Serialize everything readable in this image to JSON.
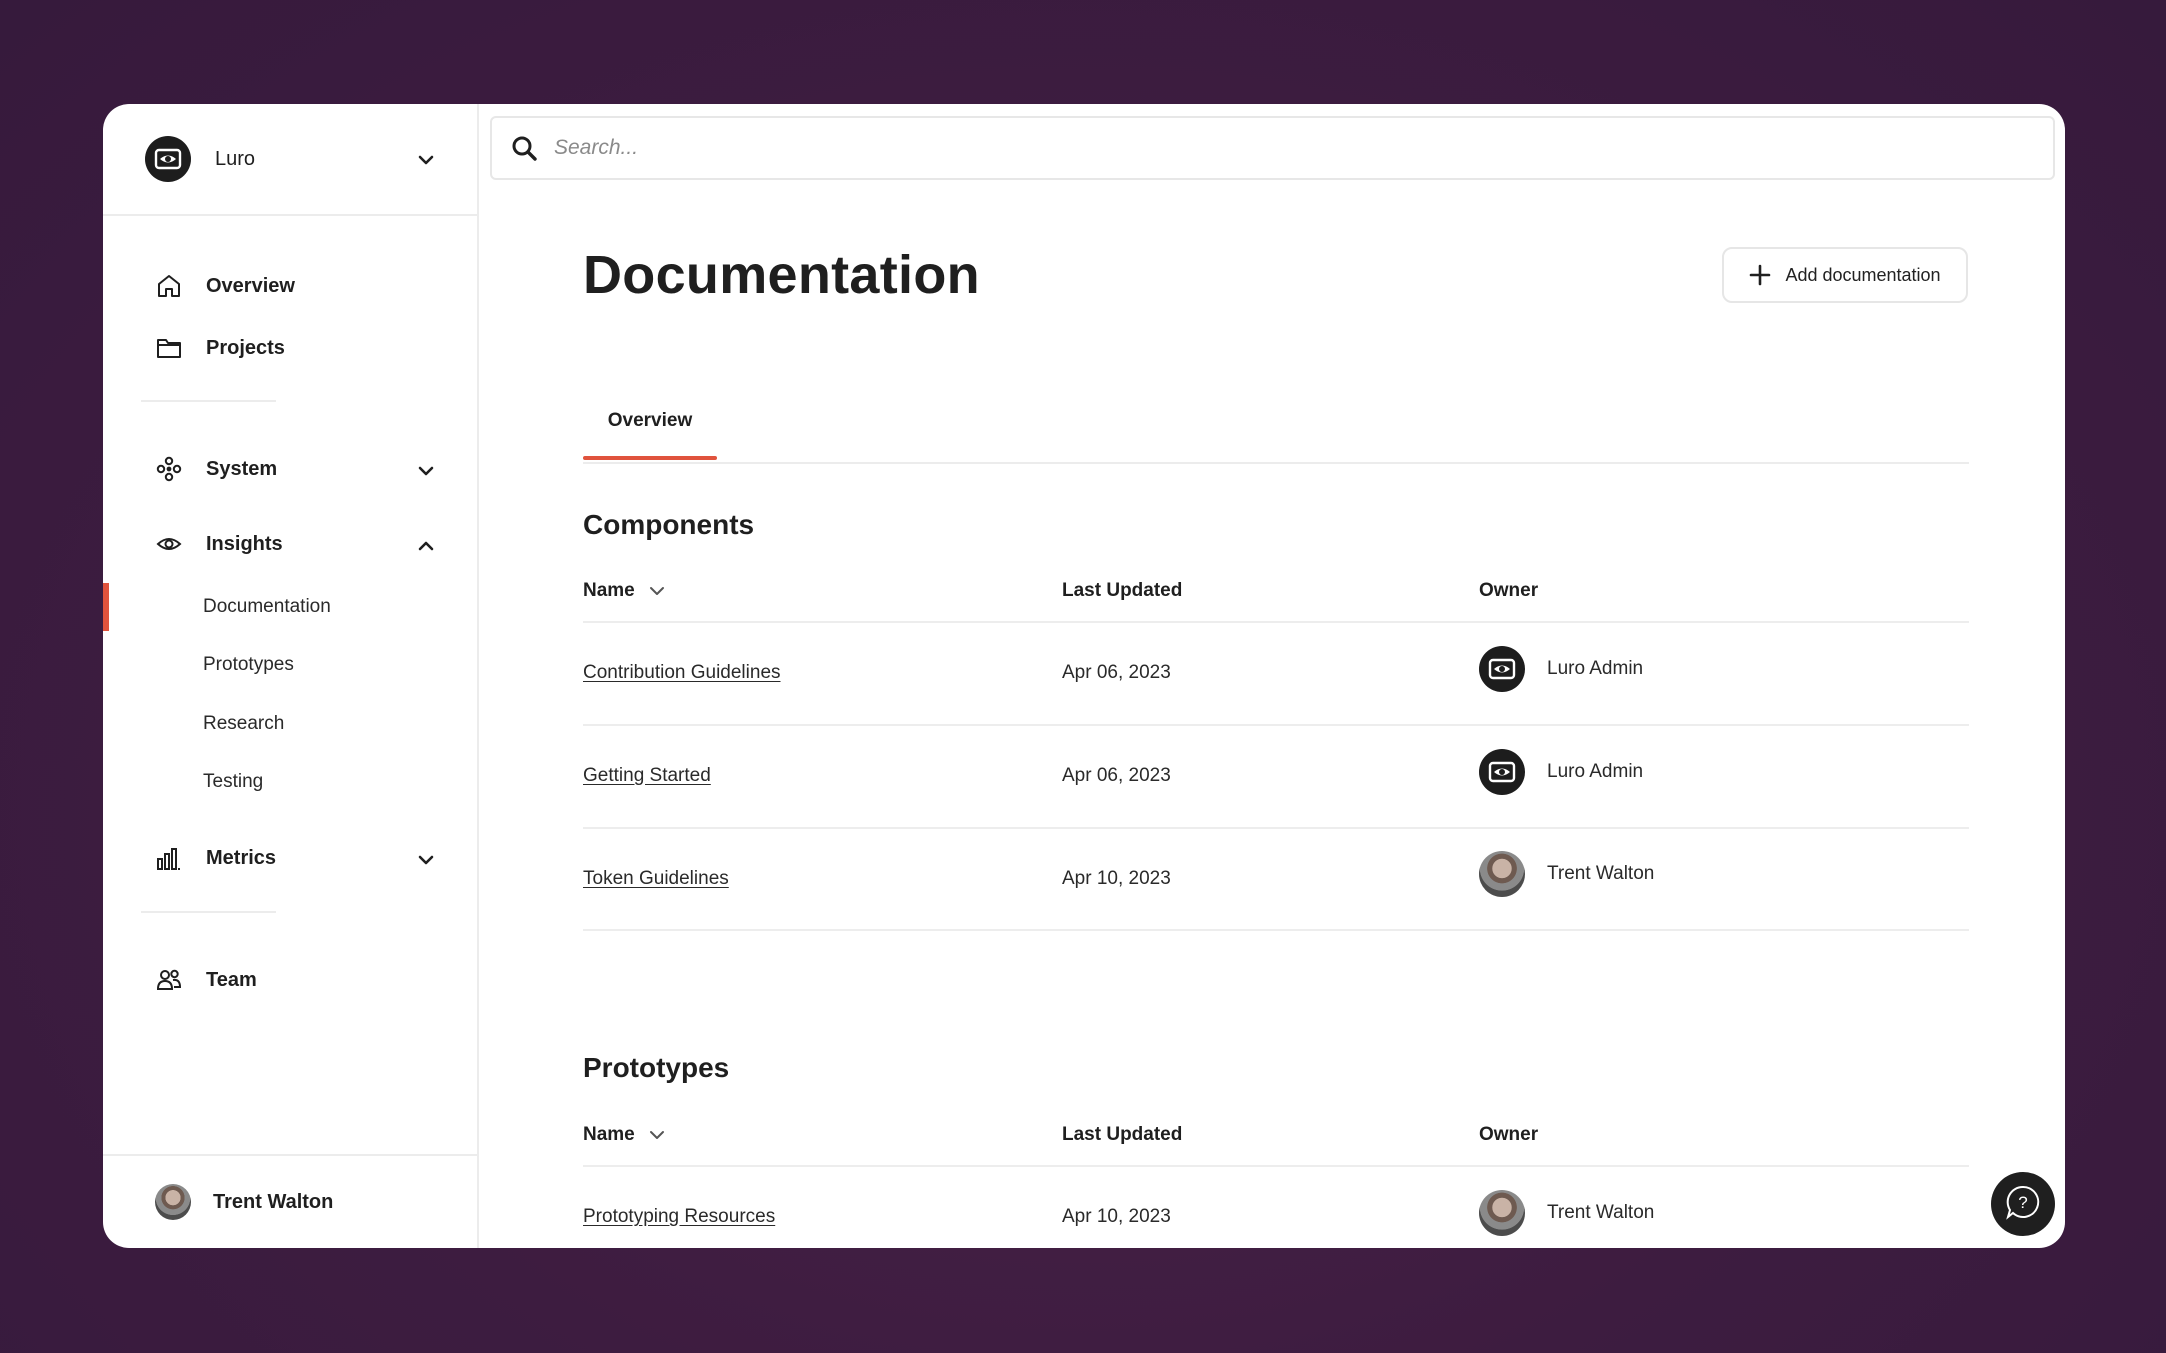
{
  "org": {
    "name": "Luro",
    "logo_icon": "luro-eye-logo"
  },
  "sidebar": {
    "primary": [
      {
        "label": "Overview",
        "icon": "home-icon"
      },
      {
        "label": "Projects",
        "icon": "folder-icon"
      }
    ],
    "groups": [
      {
        "label": "System",
        "icon": "system-icon",
        "expanded": false
      },
      {
        "label": "Insights",
        "icon": "eye-icon",
        "expanded": true,
        "children": [
          "Documentation",
          "Prototypes",
          "Research",
          "Testing"
        ],
        "active_child": "Documentation"
      },
      {
        "label": "Metrics",
        "icon": "bar-chart-icon",
        "expanded": false
      }
    ],
    "team": {
      "label": "Team",
      "icon": "team-icon"
    },
    "user": {
      "name": "Trent Walton"
    }
  },
  "search": {
    "placeholder": "Search..."
  },
  "page": {
    "title": "Documentation",
    "add_button": "Add documentation",
    "tabs": [
      {
        "label": "Overview",
        "active": true
      }
    ]
  },
  "columns": {
    "name": "Name",
    "updated": "Last Updated",
    "owner": "Owner"
  },
  "sections": [
    {
      "title": "Components",
      "rows": [
        {
          "name": "Contribution Guidelines",
          "updated": "Apr 06, 2023",
          "owner": "Luro Admin",
          "owner_avatar": "luro-logo"
        },
        {
          "name": "Getting Started",
          "updated": "Apr 06, 2023",
          "owner": "Luro Admin",
          "owner_avatar": "luro-logo"
        },
        {
          "name": "Token Guidelines",
          "updated": "Apr 10, 2023",
          "owner": "Trent Walton",
          "owner_avatar": "photo"
        }
      ]
    },
    {
      "title": "Prototypes",
      "rows": [
        {
          "name": "Prototyping Resources",
          "updated": "Apr 10, 2023",
          "owner": "Trent Walton",
          "owner_avatar": "photo"
        }
      ]
    }
  ],
  "colors": {
    "accent": "#e0533d",
    "background": "#3d1c40",
    "ink": "#1f1f1f"
  }
}
